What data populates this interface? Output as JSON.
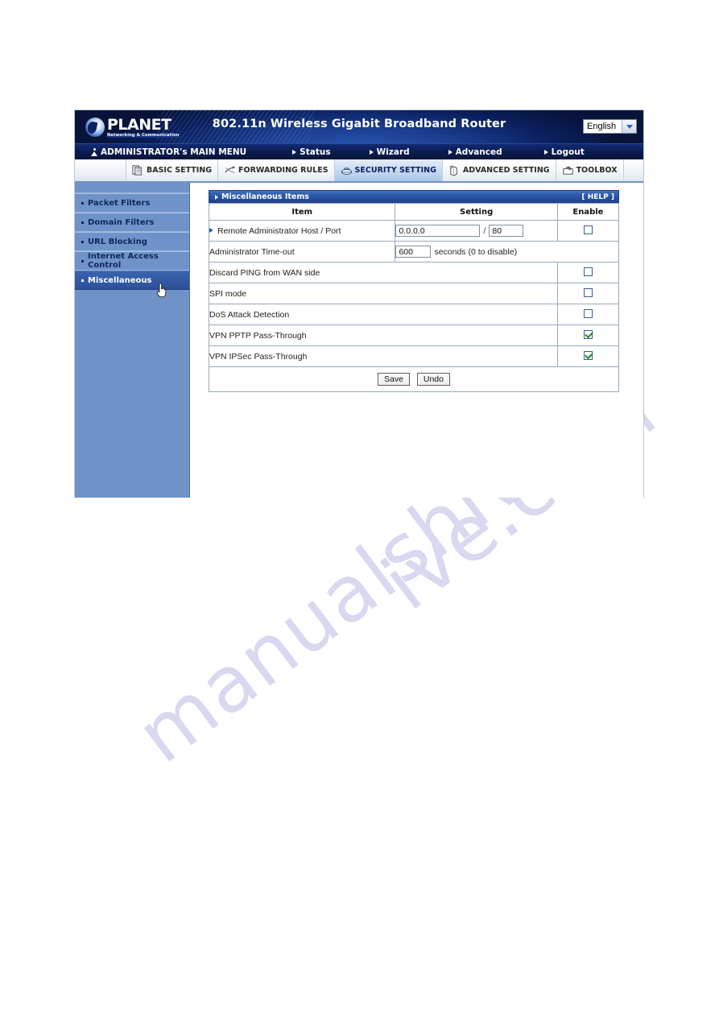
{
  "banner": {
    "logo_name": "PLANET",
    "logo_tagline": "Networking & Communication",
    "product_title": "802.11n Wireless Gigabit Broadband Router",
    "language": "English"
  },
  "mainmenu": {
    "admin": "ADMINISTRATOR's MAIN MENU",
    "items": [
      {
        "label": "Status"
      },
      {
        "label": "Wizard"
      },
      {
        "label": "Advanced"
      },
      {
        "label": "Logout"
      }
    ]
  },
  "tabs": [
    {
      "label": "BASIC SETTING",
      "icon": "documents-icon",
      "active": false
    },
    {
      "label": "FORWARDING RULES",
      "icon": "arrows-icon",
      "active": false
    },
    {
      "label": "SECURITY SETTING",
      "icon": "shield-lock-icon",
      "active": true
    },
    {
      "label": "ADVANCED SETTING",
      "icon": "box-icon",
      "active": false
    },
    {
      "label": "TOOLBOX",
      "icon": "toolbox-icon",
      "active": false
    }
  ],
  "sidebar": {
    "items": [
      {
        "label": "Packet Filters",
        "selected": false
      },
      {
        "label": "Domain Filters",
        "selected": false
      },
      {
        "label": "URL Blocking",
        "selected": false
      },
      {
        "label": "Internet Access Control",
        "selected": false
      },
      {
        "label": "Miscellaneous",
        "selected": true
      }
    ]
  },
  "panel": {
    "title": "Miscellaneous Items",
    "help": "[ HELP ]",
    "columns": {
      "item": "Item",
      "setting": "Setting",
      "enable": "Enable"
    },
    "rows": [
      {
        "label": "Remote Administrator Host / Port",
        "type": "host_port",
        "host_value": "0.0.0.0",
        "separator": "/",
        "port_value": "80",
        "checked": false,
        "has_checkbox": true,
        "marker": true
      },
      {
        "label": "Administrator Time-out",
        "type": "timeout",
        "timeout_value": "600",
        "hint": "seconds (0 to disable)",
        "has_checkbox": false,
        "marker": false
      },
      {
        "label": "Discard PING from WAN side",
        "type": "checkbox_only",
        "checked": false,
        "has_checkbox": true,
        "marker": false
      },
      {
        "label": "SPI mode",
        "type": "checkbox_only",
        "checked": false,
        "has_checkbox": true,
        "marker": false
      },
      {
        "label": "DoS Attack Detection",
        "type": "checkbox_only",
        "checked": false,
        "has_checkbox": true,
        "marker": false
      },
      {
        "label": "VPN PPTP Pass-Through",
        "type": "checkbox_only",
        "checked": true,
        "has_checkbox": true,
        "marker": false
      },
      {
        "label": "VPN IPSec Pass-Through",
        "type": "checkbox_only",
        "checked": true,
        "has_checkbox": true,
        "marker": false
      }
    ],
    "buttons": [
      {
        "label": "Save"
      },
      {
        "label": "Undo"
      }
    ]
  },
  "watermark": {
    "line1": "manualshive",
    "line2": "ive.com"
  },
  "colors": {
    "banner_navy": "#0b1f5e",
    "sidebar_blue": "#6f93c9",
    "sidebar_selected": "#2d5199",
    "panel_header": "#2a54a4",
    "check_green": "#1f8a1f"
  }
}
